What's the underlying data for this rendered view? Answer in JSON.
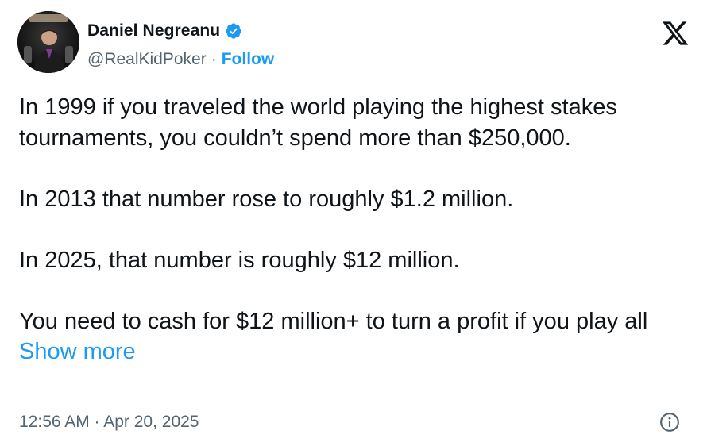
{
  "author": {
    "name": "Daniel Negreanu",
    "handle": "@RealKidPoker",
    "separator": "·",
    "follow_label": "Follow",
    "verified": true,
    "avatar_icon": "profile-photo"
  },
  "brand": {
    "logo_icon": "x-logo",
    "accent_color": "#1d9bf0",
    "text_color": "#0f1419",
    "muted_color": "#536471"
  },
  "tweet": {
    "paragraphs": [
      "In 1999 if you traveled the world playing the highest stakes tournaments, you couldn’t spend more than $250,000.",
      "In 2013 that number rose to roughly $1.2 million.",
      "In 2025, that number is roughly $12 million.",
      "You need to cash for $12 million+ to turn a profit if you play all"
    ],
    "show_more_label": "Show more"
  },
  "footer": {
    "timestamp": "12:56 AM · Apr 20, 2025",
    "info_icon": "info-icon"
  }
}
